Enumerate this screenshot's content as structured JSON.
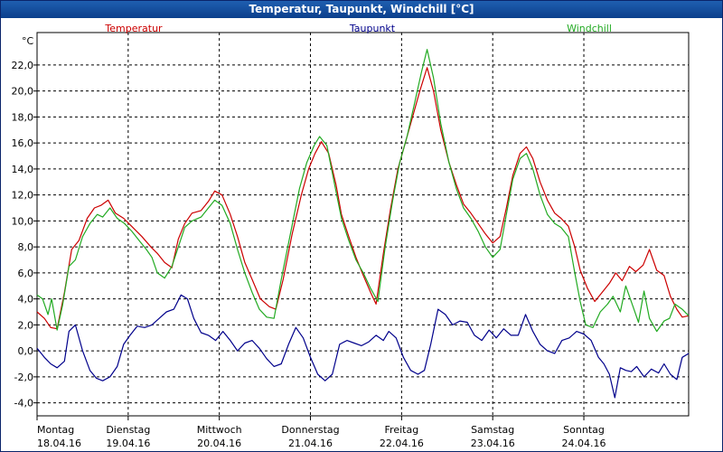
{
  "window": {
    "title": "Temperatur, Taupunkt, Windchill [°C]"
  },
  "chart_data": {
    "type": "line",
    "title": "Temperatur, Taupunkt, Windchill [°C]",
    "ylabel": "°C",
    "ylim": [
      -5,
      24.5
    ],
    "yticks": [
      -4,
      -2,
      0,
      2,
      4,
      6,
      8,
      10,
      12,
      14,
      16,
      18,
      20,
      22
    ],
    "ytick_labels": [
      "-4,0",
      "-2,0",
      "0,0",
      "2,0",
      "4,0",
      "6,0",
      "8,0",
      "10,0",
      "12,0",
      "14,0",
      "16,0",
      "18,0",
      "20,0",
      "22,0"
    ],
    "xlim": [
      0,
      7.15
    ],
    "x_ticks": [
      {
        "x": 0,
        "day": "Montag",
        "date": "18.04.16"
      },
      {
        "x": 1,
        "day": "Dienstag",
        "date": "19.04.16"
      },
      {
        "x": 2,
        "day": "Mittwoch",
        "date": "20.04.16"
      },
      {
        "x": 3,
        "day": "Donnerstag",
        "date": "21.04.16"
      },
      {
        "x": 4,
        "day": "Freitag",
        "date": "22.04.16"
      },
      {
        "x": 5,
        "day": "Samstag",
        "date": "23.04.16"
      },
      {
        "x": 6,
        "day": "Sonntag",
        "date": "24.04.16"
      }
    ],
    "grid": true,
    "legend_position": "top",
    "series": [
      {
        "name": "Temperatur",
        "color": "#cc0000",
        "points": [
          [
            0,
            3.0
          ],
          [
            0.08,
            2.5
          ],
          [
            0.15,
            1.8
          ],
          [
            0.22,
            1.7
          ],
          [
            0.3,
            4.5
          ],
          [
            0.38,
            7.8
          ],
          [
            0.46,
            8.5
          ],
          [
            0.55,
            10.2
          ],
          [
            0.63,
            11.0
          ],
          [
            0.7,
            11.2
          ],
          [
            0.78,
            11.6
          ],
          [
            0.86,
            10.6
          ],
          [
            0.95,
            10.2
          ],
          [
            1.05,
            9.5
          ],
          [
            1.15,
            8.8
          ],
          [
            1.25,
            8.0
          ],
          [
            1.32,
            7.5
          ],
          [
            1.4,
            6.8
          ],
          [
            1.48,
            6.4
          ],
          [
            1.55,
            8.6
          ],
          [
            1.62,
            9.8
          ],
          [
            1.7,
            10.6
          ],
          [
            1.8,
            10.8
          ],
          [
            1.88,
            11.5
          ],
          [
            1.95,
            12.3
          ],
          [
            2.03,
            12.0
          ],
          [
            2.12,
            10.5
          ],
          [
            2.2,
            8.8
          ],
          [
            2.28,
            6.8
          ],
          [
            2.36,
            5.5
          ],
          [
            2.45,
            4.0
          ],
          [
            2.55,
            3.4
          ],
          [
            2.62,
            3.2
          ],
          [
            2.7,
            5.5
          ],
          [
            2.8,
            9.0
          ],
          [
            2.9,
            12.0
          ],
          [
            2.98,
            14.0
          ],
          [
            3.05,
            15.2
          ],
          [
            3.12,
            16.1
          ],
          [
            3.2,
            15.2
          ],
          [
            3.28,
            12.8
          ],
          [
            3.34,
            10.5
          ],
          [
            3.42,
            8.8
          ],
          [
            3.5,
            7.2
          ],
          [
            3.58,
            5.8
          ],
          [
            3.66,
            4.5
          ],
          [
            3.72,
            3.6
          ],
          [
            3.8,
            7.5
          ],
          [
            3.88,
            11.0
          ],
          [
            3.96,
            14.0
          ],
          [
            4.04,
            16.0
          ],
          [
            4.12,
            18.0
          ],
          [
            4.2,
            20.0
          ],
          [
            4.28,
            21.8
          ],
          [
            4.35,
            20.0
          ],
          [
            4.43,
            17.0
          ],
          [
            4.52,
            14.5
          ],
          [
            4.6,
            12.8
          ],
          [
            4.68,
            11.3
          ],
          [
            4.76,
            10.6
          ],
          [
            4.84,
            9.8
          ],
          [
            4.92,
            9.0
          ],
          [
            5.0,
            8.3
          ],
          [
            5.08,
            8.8
          ],
          [
            5.15,
            11.0
          ],
          [
            5.22,
            13.5
          ],
          [
            5.3,
            15.2
          ],
          [
            5.37,
            15.7
          ],
          [
            5.44,
            14.8
          ],
          [
            5.52,
            13.0
          ],
          [
            5.6,
            11.6
          ],
          [
            5.68,
            10.6
          ],
          [
            5.75,
            10.2
          ],
          [
            5.83,
            9.6
          ],
          [
            5.9,
            8.0
          ],
          [
            5.96,
            6.2
          ],
          [
            6.04,
            4.8
          ],
          [
            6.12,
            3.8
          ],
          [
            6.2,
            4.5
          ],
          [
            6.28,
            5.2
          ],
          [
            6.35,
            6.0
          ],
          [
            6.42,
            5.4
          ],
          [
            6.5,
            6.5
          ],
          [
            6.57,
            6.1
          ],
          [
            6.65,
            6.6
          ],
          [
            6.72,
            7.8
          ],
          [
            6.8,
            6.2
          ],
          [
            6.88,
            5.8
          ],
          [
            6.95,
            4.2
          ],
          [
            7.02,
            3.2
          ],
          [
            7.08,
            2.6
          ],
          [
            7.15,
            2.7
          ]
        ]
      },
      {
        "name": "Taupunkt",
        "color": "#00008b",
        "points": [
          [
            0,
            0.2
          ],
          [
            0.08,
            -0.5
          ],
          [
            0.15,
            -1.0
          ],
          [
            0.22,
            -1.3
          ],
          [
            0.3,
            -0.8
          ],
          [
            0.35,
            1.5
          ],
          [
            0.42,
            2.0
          ],
          [
            0.5,
            0.0
          ],
          [
            0.58,
            -1.5
          ],
          [
            0.65,
            -2.1
          ],
          [
            0.72,
            -2.3
          ],
          [
            0.8,
            -2.0
          ],
          [
            0.88,
            -1.2
          ],
          [
            0.95,
            0.5
          ],
          [
            1.02,
            1.2
          ],
          [
            1.1,
            1.9
          ],
          [
            1.18,
            1.8
          ],
          [
            1.26,
            2.0
          ],
          [
            1.34,
            2.5
          ],
          [
            1.42,
            3.0
          ],
          [
            1.5,
            3.2
          ],
          [
            1.58,
            4.3
          ],
          [
            1.65,
            4.0
          ],
          [
            1.72,
            2.5
          ],
          [
            1.8,
            1.4
          ],
          [
            1.88,
            1.2
          ],
          [
            1.96,
            0.8
          ],
          [
            2.04,
            1.5
          ],
          [
            2.12,
            0.8
          ],
          [
            2.2,
            0.0
          ],
          [
            2.28,
            0.6
          ],
          [
            2.36,
            0.8
          ],
          [
            2.44,
            0.2
          ],
          [
            2.52,
            -0.6
          ],
          [
            2.6,
            -1.2
          ],
          [
            2.68,
            -1.0
          ],
          [
            2.76,
            0.5
          ],
          [
            2.84,
            1.8
          ],
          [
            2.92,
            1.0
          ],
          [
            3.0,
            -0.5
          ],
          [
            3.08,
            -1.8
          ],
          [
            3.16,
            -2.3
          ],
          [
            3.24,
            -1.8
          ],
          [
            3.32,
            0.5
          ],
          [
            3.4,
            0.8
          ],
          [
            3.48,
            0.6
          ],
          [
            3.56,
            0.4
          ],
          [
            3.64,
            0.7
          ],
          [
            3.72,
            1.2
          ],
          [
            3.8,
            0.8
          ],
          [
            3.86,
            1.5
          ],
          [
            3.94,
            1.0
          ],
          [
            4.02,
            -0.5
          ],
          [
            4.1,
            -1.5
          ],
          [
            4.18,
            -1.8
          ],
          [
            4.25,
            -1.5
          ],
          [
            4.32,
            0.5
          ],
          [
            4.4,
            3.2
          ],
          [
            4.48,
            2.8
          ],
          [
            4.56,
            2.0
          ],
          [
            4.64,
            2.3
          ],
          [
            4.72,
            2.2
          ],
          [
            4.8,
            1.2
          ],
          [
            4.88,
            0.8
          ],
          [
            4.96,
            1.6
          ],
          [
            5.04,
            1.0
          ],
          [
            5.12,
            1.7
          ],
          [
            5.2,
            1.2
          ],
          [
            5.28,
            1.2
          ],
          [
            5.36,
            2.8
          ],
          [
            5.44,
            1.5
          ],
          [
            5.52,
            0.5
          ],
          [
            5.6,
            0.0
          ],
          [
            5.68,
            -0.2
          ],
          [
            5.76,
            0.8
          ],
          [
            5.84,
            1.0
          ],
          [
            5.92,
            1.5
          ],
          [
            6.0,
            1.3
          ],
          [
            6.08,
            0.8
          ],
          [
            6.16,
            -0.5
          ],
          [
            6.22,
            -1.0
          ],
          [
            6.28,
            -1.8
          ],
          [
            6.34,
            -3.6
          ],
          [
            6.4,
            -1.3
          ],
          [
            6.46,
            -1.5
          ],
          [
            6.52,
            -1.6
          ],
          [
            6.58,
            -1.2
          ],
          [
            6.66,
            -2.0
          ],
          [
            6.74,
            -1.4
          ],
          [
            6.82,
            -1.7
          ],
          [
            6.88,
            -1.0
          ],
          [
            6.95,
            -1.8
          ],
          [
            7.02,
            -2.2
          ],
          [
            7.08,
            -0.5
          ],
          [
            7.15,
            -0.2
          ]
        ]
      },
      {
        "name": "Windchill",
        "color": "#22aa22",
        "points": [
          [
            0,
            4.3
          ],
          [
            0.06,
            4.0
          ],
          [
            0.12,
            2.8
          ],
          [
            0.16,
            4.0
          ],
          [
            0.22,
            1.6
          ],
          [
            0.28,
            3.5
          ],
          [
            0.35,
            6.5
          ],
          [
            0.42,
            7.0
          ],
          [
            0.5,
            8.8
          ],
          [
            0.58,
            9.8
          ],
          [
            0.66,
            10.5
          ],
          [
            0.72,
            10.3
          ],
          [
            0.8,
            11.0
          ],
          [
            0.88,
            10.2
          ],
          [
            0.96,
            9.8
          ],
          [
            1.04,
            9.2
          ],
          [
            1.12,
            8.5
          ],
          [
            1.2,
            7.8
          ],
          [
            1.26,
            7.2
          ],
          [
            1.32,
            6.0
          ],
          [
            1.4,
            5.6
          ],
          [
            1.48,
            6.5
          ],
          [
            1.55,
            8.0
          ],
          [
            1.62,
            9.5
          ],
          [
            1.7,
            10.0
          ],
          [
            1.8,
            10.3
          ],
          [
            1.88,
            11.0
          ],
          [
            1.95,
            11.6
          ],
          [
            2.03,
            11.2
          ],
          [
            2.12,
            9.8
          ],
          [
            2.2,
            7.8
          ],
          [
            2.28,
            6.0
          ],
          [
            2.36,
            4.5
          ],
          [
            2.44,
            3.2
          ],
          [
            2.52,
            2.6
          ],
          [
            2.6,
            2.5
          ],
          [
            2.68,
            5.5
          ],
          [
            2.78,
            9.0
          ],
          [
            2.88,
            12.5
          ],
          [
            2.96,
            14.5
          ],
          [
            3.04,
            15.8
          ],
          [
            3.1,
            16.5
          ],
          [
            3.18,
            15.8
          ],
          [
            3.26,
            13.0
          ],
          [
            3.34,
            10.2
          ],
          [
            3.42,
            8.5
          ],
          [
            3.5,
            7.0
          ],
          [
            3.58,
            6.0
          ],
          [
            3.66,
            4.8
          ],
          [
            3.74,
            3.8
          ],
          [
            3.82,
            8.0
          ],
          [
            3.9,
            11.5
          ],
          [
            3.98,
            14.5
          ],
          [
            4.06,
            16.5
          ],
          [
            4.14,
            19.0
          ],
          [
            4.22,
            21.5
          ],
          [
            4.28,
            23.2
          ],
          [
            4.35,
            21.0
          ],
          [
            4.43,
            17.5
          ],
          [
            4.52,
            14.5
          ],
          [
            4.6,
            12.5
          ],
          [
            4.68,
            11.0
          ],
          [
            4.76,
            10.2
          ],
          [
            4.84,
            9.2
          ],
          [
            4.92,
            8.0
          ],
          [
            5.0,
            7.2
          ],
          [
            5.08,
            7.8
          ],
          [
            5.15,
            10.5
          ],
          [
            5.22,
            13.2
          ],
          [
            5.3,
            14.8
          ],
          [
            5.37,
            15.2
          ],
          [
            5.44,
            14.0
          ],
          [
            5.52,
            12.0
          ],
          [
            5.6,
            10.5
          ],
          [
            5.68,
            9.8
          ],
          [
            5.75,
            9.5
          ],
          [
            5.83,
            8.8
          ],
          [
            5.9,
            6.0
          ],
          [
            5.96,
            3.8
          ],
          [
            6.02,
            2.0
          ],
          [
            6.1,
            1.8
          ],
          [
            6.18,
            3.0
          ],
          [
            6.26,
            3.6
          ],
          [
            6.32,
            4.2
          ],
          [
            6.4,
            3.0
          ],
          [
            6.46,
            5.0
          ],
          [
            6.54,
            3.4
          ],
          [
            6.6,
            2.2
          ],
          [
            6.66,
            4.6
          ],
          [
            6.72,
            2.5
          ],
          [
            6.8,
            1.5
          ],
          [
            6.88,
            2.3
          ],
          [
            6.94,
            2.5
          ],
          [
            7.0,
            3.6
          ],
          [
            7.08,
            3.2
          ],
          [
            7.15,
            2.7
          ]
        ]
      }
    ]
  }
}
